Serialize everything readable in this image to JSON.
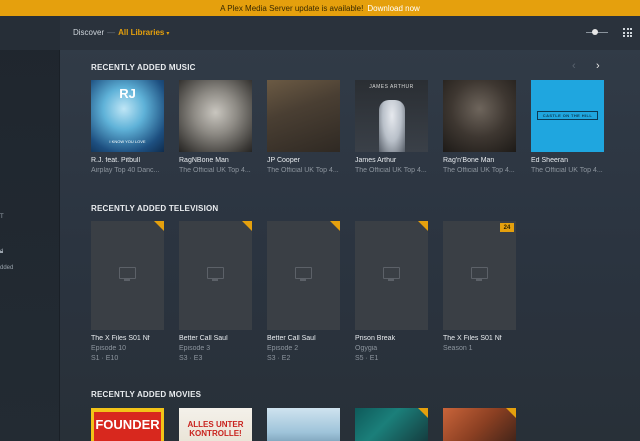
{
  "banner": {
    "text": "A Plex Media Server update is available!",
    "link": "Download now"
  },
  "topbar": {
    "discover": "Discover",
    "separator": "—",
    "library_filter": "All Libraries",
    "caret": "▾"
  },
  "sidebar": {
    "fragments": [
      "T",
      "d",
      "dded"
    ]
  },
  "nav": {
    "prev": "‹",
    "next": "›"
  },
  "sections": {
    "music": {
      "title": "RECENTLY ADDED MUSIC",
      "items": [
        {
          "title": "R.J. feat. Pitbull",
          "subtitle": "Airplay Top 40 Danc...",
          "art_text": "RJ",
          "art_sub": "I KNOW YOU LOVE"
        },
        {
          "title": "RagNBone Man",
          "subtitle": "The Official UK Top 4..."
        },
        {
          "title": "JP Cooper",
          "subtitle": "The Official UK Top 4..."
        },
        {
          "title": "James Arthur",
          "subtitle": "The Official UK Top 4...",
          "art_text": "JAMES ARTHUR"
        },
        {
          "title": "Rag'n'Bone Man",
          "subtitle": "The Official UK Top 4..."
        },
        {
          "title": "Ed Sheeran",
          "subtitle": "The Official UK Top 4...",
          "art_text": "CASTLE ON THE HILL"
        }
      ]
    },
    "television": {
      "title": "RECENTLY ADDED TELEVISION",
      "items": [
        {
          "title": "The X Files S01 Nf",
          "subtitle": "Episode 10",
          "meta": "S1 · E10"
        },
        {
          "title": "Better Call Saul",
          "subtitle": "Episode 3",
          "meta": "S3 · E3"
        },
        {
          "title": "Better Call Saul",
          "subtitle": "Episode 2",
          "meta": "S3 · E2"
        },
        {
          "title": "Prison Break",
          "subtitle": "Ogygia",
          "meta": "S5 · E1"
        },
        {
          "title": "The X Files S01 Nf",
          "subtitle": "Season 1",
          "meta": "",
          "badge": "24"
        }
      ]
    },
    "movies": {
      "title": "RECENTLY ADDED MOVIES",
      "items": [
        {
          "art_text": "FOUNDER"
        },
        {
          "art_text": "ALLES UNTER KONTROLLE!"
        },
        {
          "art_text": ""
        },
        {
          "art_text": ""
        },
        {
          "art_text": ""
        }
      ]
    }
  },
  "colors": {
    "accent": "#e5a00d",
    "background": "#2e3844",
    "topbar": "#2a323c",
    "sidebar": "#1f262e"
  }
}
